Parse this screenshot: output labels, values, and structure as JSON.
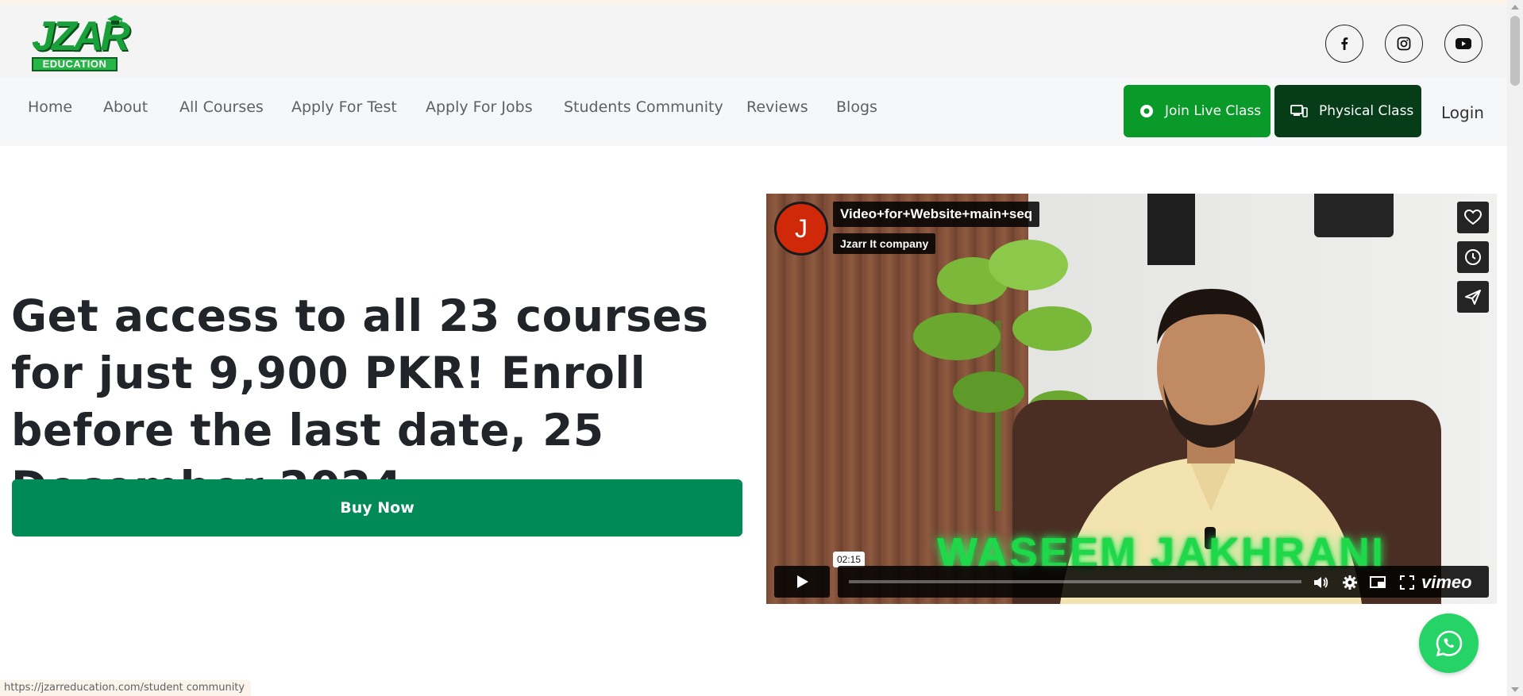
{
  "brand": {
    "logo_main": "JZAR",
    "logo_sub": "EDUCATION"
  },
  "social": [
    {
      "name": "facebook-icon"
    },
    {
      "name": "instagram-icon"
    },
    {
      "name": "youtube-icon"
    }
  ],
  "nav": {
    "items": [
      "Home",
      "About",
      "All Courses",
      "Apply For Test",
      "Apply For Jobs",
      "Students Community",
      "Reviews",
      "Blogs"
    ],
    "join_live": "Join Live Class",
    "physical": "Physical Class",
    "login": "Login"
  },
  "hero": {
    "title": "Get access to all 23 courses for just 9,900 PKR! Enroll before the last date, 25 December 2024.",
    "buy_label": "Buy Now"
  },
  "video": {
    "avatar_letter": "J",
    "title": "Video+for+Website+main+seq",
    "channel": "Jzarr It company",
    "overlay_text": "WASEEM JAKHRANI",
    "time": "02:15",
    "brand": "vimeo"
  },
  "status_url": "https://jzarreducation.com/student community",
  "colors": {
    "join_live_bg": "#0a9a2a",
    "physical_bg": "#063d18",
    "buy_bg": "#008a58",
    "whatsapp": "#25d366"
  }
}
